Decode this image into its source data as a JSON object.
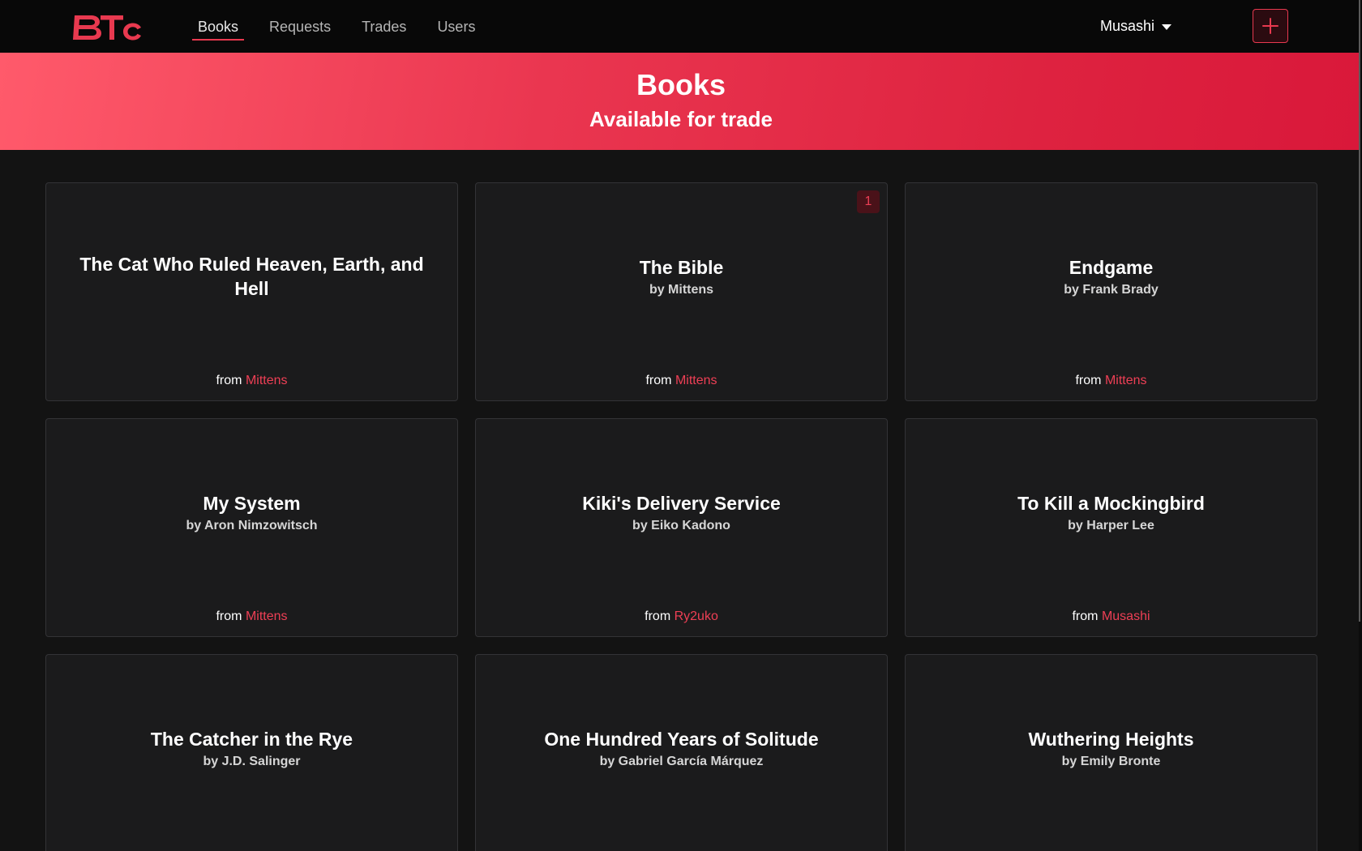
{
  "brand": {
    "logo_text": "BTc",
    "accent_color": "#e8394f"
  },
  "nav": {
    "items": [
      {
        "label": "Books",
        "active": true
      },
      {
        "label": "Requests",
        "active": false
      },
      {
        "label": "Trades",
        "active": false
      },
      {
        "label": "Users",
        "active": false
      }
    ]
  },
  "user_menu": {
    "username": "Musashi",
    "caret_icon": "caret-down-icon"
  },
  "add_button": {
    "icon": "plus-icon"
  },
  "hero": {
    "title": "Books",
    "subtitle": "Available for trade"
  },
  "owner_prefix": "from",
  "books": [
    {
      "title": "The Cat Who Ruled Heaven, Earth, and Hell",
      "author": "",
      "owner": "Mittens",
      "requests": ""
    },
    {
      "title": "The Bible",
      "author": "by Mittens",
      "owner": "Mittens",
      "requests": "1"
    },
    {
      "title": "Endgame",
      "author": "by Frank Brady",
      "owner": "Mittens",
      "requests": ""
    },
    {
      "title": "My System",
      "author": "by Aron Nimzowitsch",
      "owner": "Mittens",
      "requests": ""
    },
    {
      "title": "Kiki's Delivery Service",
      "author": "by Eiko Kadono",
      "owner": "Ry2uko",
      "requests": ""
    },
    {
      "title": "To Kill a Mockingbird",
      "author": "by Harper Lee",
      "owner": "Musashi",
      "requests": ""
    },
    {
      "title": "The Catcher in the Rye",
      "author": "by J.D. Salinger",
      "owner": "",
      "requests": ""
    },
    {
      "title": "One Hundred Years of Solitude",
      "author": "by Gabriel García Márquez",
      "owner": "",
      "requests": ""
    },
    {
      "title": "Wuthering Heights",
      "author": "by Emily Bronte",
      "owner": "",
      "requests": ""
    }
  ]
}
